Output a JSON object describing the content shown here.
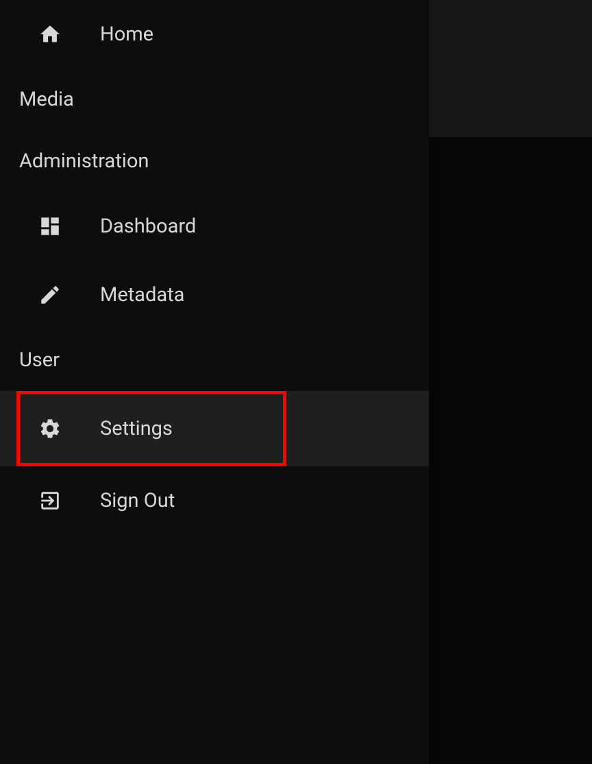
{
  "nav": {
    "home": "Home"
  },
  "sections": {
    "media": "Media",
    "administration": "Administration",
    "user": "User"
  },
  "admin_items": {
    "dashboard": "Dashboard",
    "metadata": "Metadata"
  },
  "user_items": {
    "settings": "Settings",
    "signout": "Sign Out"
  }
}
